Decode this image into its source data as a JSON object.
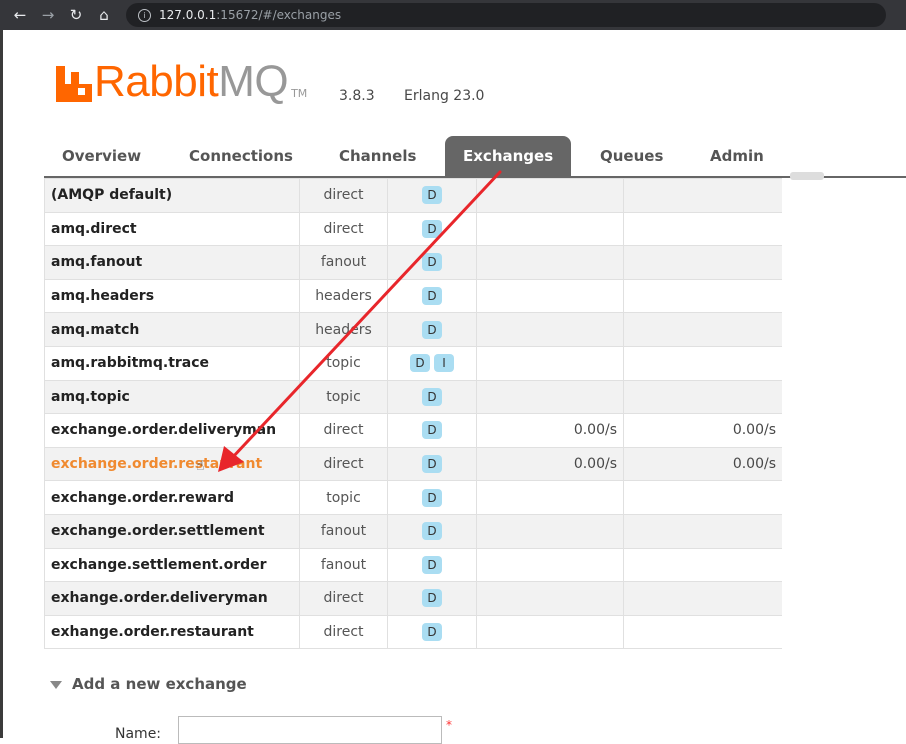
{
  "browser": {
    "url_host": "127.0.0.1",
    "url_rest": ":15672/#/exchanges"
  },
  "header": {
    "version": "3.8.3",
    "erlang": "Erlang 23.0",
    "logo": {
      "rabbit": "Rabbit",
      "mq": "MQ",
      "tm": "TM"
    }
  },
  "tabs": [
    {
      "label": "Overview",
      "active": false
    },
    {
      "label": "Connections",
      "active": false
    },
    {
      "label": "Channels",
      "active": false
    },
    {
      "label": "Exchanges",
      "active": true
    },
    {
      "label": "Queues",
      "active": false
    },
    {
      "label": "Admin",
      "active": false
    }
  ],
  "exchanges": [
    {
      "name": "(AMQP default)",
      "type": "direct",
      "features": [
        "D"
      ],
      "rate_in": "",
      "rate_out": ""
    },
    {
      "name": "amq.direct",
      "type": "direct",
      "features": [
        "D"
      ],
      "rate_in": "",
      "rate_out": ""
    },
    {
      "name": "amq.fanout",
      "type": "fanout",
      "features": [
        "D"
      ],
      "rate_in": "",
      "rate_out": ""
    },
    {
      "name": "amq.headers",
      "type": "headers",
      "features": [
        "D"
      ],
      "rate_in": "",
      "rate_out": ""
    },
    {
      "name": "amq.match",
      "type": "headers",
      "features": [
        "D"
      ],
      "rate_in": "",
      "rate_out": ""
    },
    {
      "name": "amq.rabbitmq.trace",
      "type": "topic",
      "features": [
        "D",
        "I"
      ],
      "rate_in": "",
      "rate_out": ""
    },
    {
      "name": "amq.topic",
      "type": "topic",
      "features": [
        "D"
      ],
      "rate_in": "",
      "rate_out": ""
    },
    {
      "name": "exchange.order.deliveryman",
      "type": "direct",
      "features": [
        "D"
      ],
      "rate_in": "0.00/s",
      "rate_out": "0.00/s"
    },
    {
      "name": "exchange.order.restaurant",
      "type": "direct",
      "features": [
        "D"
      ],
      "rate_in": "0.00/s",
      "rate_out": "0.00/s",
      "highlighted": true
    },
    {
      "name": "exchange.order.reward",
      "type": "topic",
      "features": [
        "D"
      ],
      "rate_in": "",
      "rate_out": ""
    },
    {
      "name": "exchange.order.settlement",
      "type": "fanout",
      "features": [
        "D"
      ],
      "rate_in": "",
      "rate_out": ""
    },
    {
      "name": "exchange.settlement.order",
      "type": "fanout",
      "features": [
        "D"
      ],
      "rate_in": "",
      "rate_out": ""
    },
    {
      "name": "exhange.order.deliveryman",
      "type": "direct",
      "features": [
        "D"
      ],
      "rate_in": "",
      "rate_out": ""
    },
    {
      "name": "exhange.order.restaurant",
      "type": "direct",
      "features": [
        "D"
      ],
      "rate_in": "",
      "rate_out": ""
    }
  ],
  "add_exchange": {
    "toggle_label": "Add a new exchange",
    "name_label": "Name:",
    "required_mark": "*",
    "name_value": ""
  },
  "colors": {
    "brand": "#ff6600",
    "tab_active": "#666666",
    "badge": "#aaddf2",
    "annotation": "#e8262b"
  }
}
